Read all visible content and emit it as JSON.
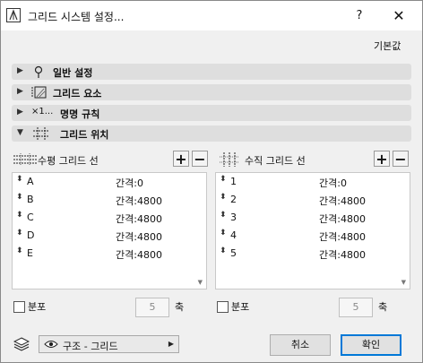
{
  "window": {
    "title": "그리드 시스템 설정...",
    "help": "?",
    "close": "✕"
  },
  "default_link": "기본값",
  "sections": [
    {
      "label": "일반 설정",
      "icon": "pin-icon"
    },
    {
      "label": "그리드 요소",
      "icon": "grid-element-icon"
    },
    {
      "label": "명명 규칙",
      "icon": "naming-icon",
      "icon_text": "×1..."
    },
    {
      "label": "그리드 위치",
      "icon": "grid-position-icon",
      "expanded": true
    }
  ],
  "horizontal": {
    "title": "수평 그리드 선",
    "rows": [
      {
        "name": "A",
        "spacing": "간격:0"
      },
      {
        "name": "B",
        "spacing": "간격:4800"
      },
      {
        "name": "C",
        "spacing": "간격:4800"
      },
      {
        "name": "D",
        "spacing": "간격:4800"
      },
      {
        "name": "E",
        "spacing": "간격:4800"
      }
    ],
    "distribute_label": "분포",
    "count": "5",
    "axis_label": "축"
  },
  "vertical": {
    "title": "수직 그리드 선",
    "rows": [
      {
        "name": "1",
        "spacing": "간격:0"
      },
      {
        "name": "2",
        "spacing": "간격:4800"
      },
      {
        "name": "3",
        "spacing": "간격:4800"
      },
      {
        "name": "4",
        "spacing": "간격:4800"
      },
      {
        "name": "5",
        "spacing": "간격:4800"
      }
    ],
    "distribute_label": "분포",
    "count": "5",
    "axis_label": "축"
  },
  "symbols": {
    "plus": "+",
    "minus": "−",
    "expanded_arrow": "▼",
    "collapsed_arrow": "▶",
    "row_handle": "⬍",
    "dropdown_arrow": "▶",
    "scroll_down": "▼"
  },
  "layer": {
    "value": "구조 - 그리드"
  },
  "buttons": {
    "cancel": "취소",
    "ok": "확인"
  },
  "colors": {
    "accent": "#0078d7",
    "section_bg": "#dedede"
  }
}
